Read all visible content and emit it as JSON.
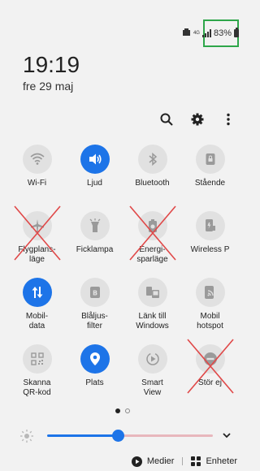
{
  "status": {
    "battery_percent": "83%",
    "network_type": "4G"
  },
  "clock": {
    "time": "19:19",
    "date": "fre 29 maj"
  },
  "tiles": [
    {
      "label": "Wi-Fi",
      "icon": "wifi-icon",
      "on": false
    },
    {
      "label": "Ljud",
      "icon": "volume-icon",
      "on": true
    },
    {
      "label": "Bluetooth",
      "icon": "bluetooth-icon",
      "on": false
    },
    {
      "label": "Stående",
      "icon": "portrait-lock-icon",
      "on": false
    },
    {
      "label": "Flygplans-\nläge",
      "icon": "airplane-icon",
      "on": false,
      "crossed": true
    },
    {
      "label": "Ficklampa",
      "icon": "flashlight-icon",
      "on": false
    },
    {
      "label": "Energi-\nsparläge",
      "icon": "battery-saver-icon",
      "on": false,
      "crossed": true
    },
    {
      "label": "Wireless P",
      "icon": "wireless-powershare-icon",
      "on": false
    },
    {
      "label": "Mobil-\ndata",
      "icon": "mobile-data-icon",
      "on": true
    },
    {
      "label": "Blåljus-\nfilter",
      "icon": "blue-light-filter-icon",
      "on": false
    },
    {
      "label": "Länk till\nWindows",
      "icon": "link-to-windows-icon",
      "on": false
    },
    {
      "label": "Mobil\nhotspot",
      "icon": "hotspot-icon",
      "on": false
    },
    {
      "label": "Skanna\nQR-kod",
      "icon": "qr-code-icon",
      "on": false
    },
    {
      "label": "Plats",
      "icon": "location-icon",
      "on": true
    },
    {
      "label": "Smart\nView",
      "icon": "smart-view-icon",
      "on": false
    },
    {
      "label": "Stör ej",
      "icon": "do-not-disturb-icon",
      "on": false,
      "crossed": true
    }
  ],
  "brightness": {
    "level_fraction": 0.43
  },
  "page_indicator": {
    "current": 1,
    "total": 2
  },
  "bottom": {
    "media_label": "Medier",
    "devices_label": "Enheter"
  },
  "colors": {
    "accent": "#1d74e8",
    "tile_off": "#e1e1e1",
    "cross": "#e04848",
    "highlight": "#2ea64a"
  }
}
